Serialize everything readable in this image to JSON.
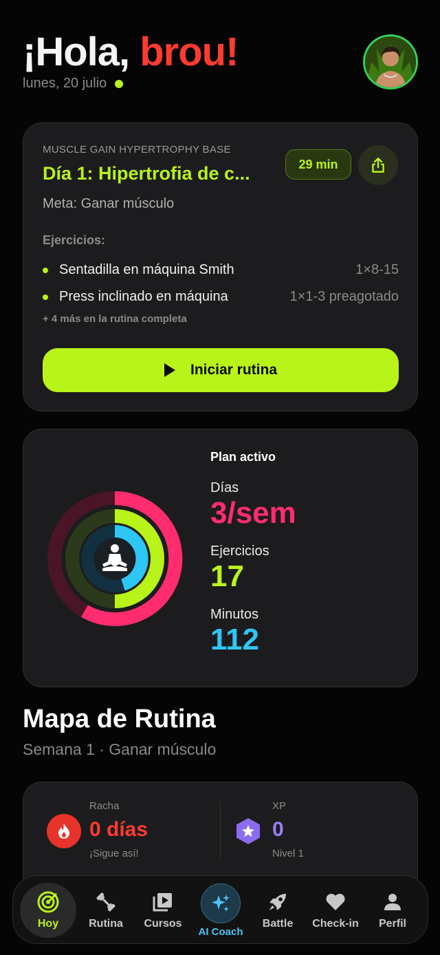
{
  "header": {
    "greeting": "¡Hola, ",
    "name": "brou!",
    "date": "lunes, 20 julio"
  },
  "workout": {
    "program": "MUSCLE GAIN HYPERTROPHY BASE",
    "title": "Día 1: Hipertrofia de c...",
    "duration": "29 min",
    "goal": "Meta: Ganar músculo",
    "exercises_label": "Ejercicios:",
    "exercises": [
      {
        "name": "Sentadilla en máquina Smith",
        "sets": "1×8-15"
      },
      {
        "name": "Press inclinado en máquina",
        "sets": "1×1-3 preagotado"
      }
    ],
    "more": "+ 4 más en la rutina completa",
    "start_label": "Iniciar rutina"
  },
  "plan": {
    "title": "Plan activo",
    "days_label": "Días",
    "days_value": "3/sem",
    "exercises_label": "Ejercicios",
    "exercises_value": "17",
    "minutes_label": "Minutos",
    "minutes_value": "112",
    "colors": {
      "days": "#ff2d6f",
      "exercises": "#b8f31a",
      "minutes": "#2ec6f5"
    }
  },
  "map": {
    "title": "Mapa de Rutina",
    "subtitle": "Semana 1 · Ganar músculo"
  },
  "stats": {
    "streak_label": "Racha",
    "streak_value": "0 días",
    "streak_sub": "¡Sigue así!",
    "xp_label": "XP",
    "xp_value": "0",
    "xp_sub": "Nivel 1"
  },
  "nav": {
    "items": [
      {
        "label": "Hoy",
        "icon": "target-icon"
      },
      {
        "label": "Rutina",
        "icon": "dumbbell-icon"
      },
      {
        "label": "Cursos",
        "icon": "video-library-icon"
      },
      {
        "label": "AI Coach",
        "icon": "sparkles-icon"
      },
      {
        "label": "Battle",
        "icon": "rocket-icon"
      },
      {
        "label": "Check-in",
        "icon": "heart-icon"
      },
      {
        "label": "Perfil",
        "icon": "person-icon"
      }
    ]
  }
}
